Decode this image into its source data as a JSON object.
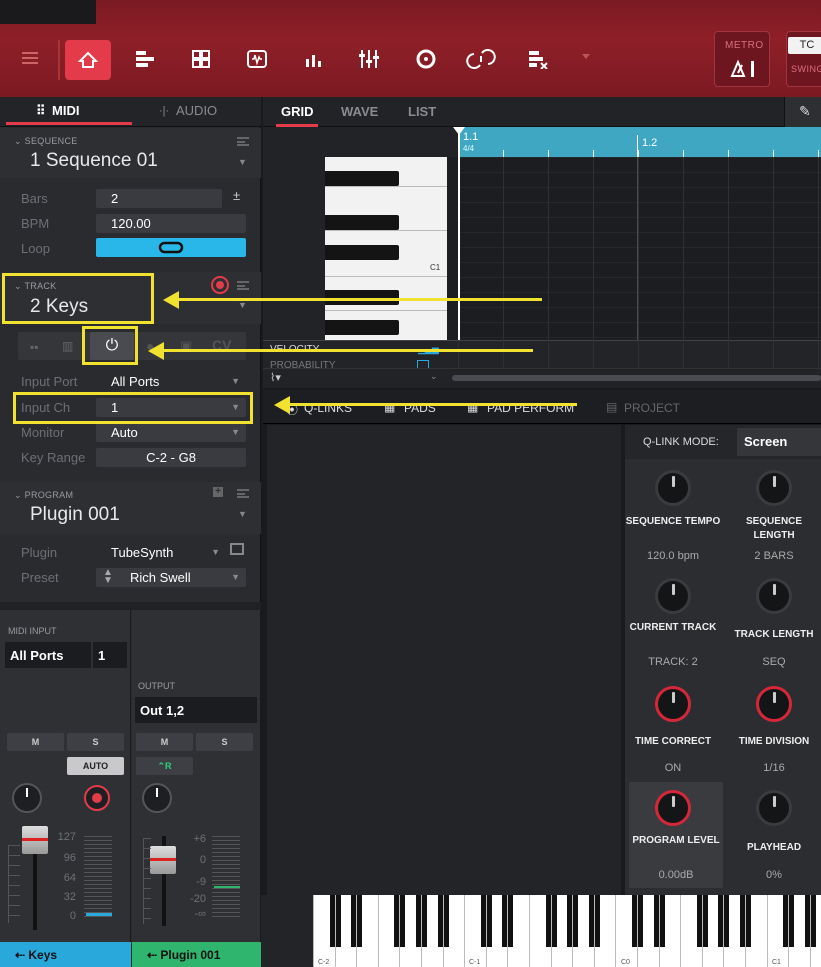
{
  "topbar": {
    "metro_label": "METRO",
    "tc_label": "TC",
    "swing_label": "SWING"
  },
  "left": {
    "tabs": {
      "midi": "MIDI",
      "audio": "AUDIO"
    },
    "sequence": {
      "header": "SEQUENCE",
      "title": "1 Sequence 01",
      "bars_label": "Bars",
      "bars_value": "2",
      "bpm_label": "BPM",
      "bpm_value": "120.00",
      "loop_label": "Loop"
    },
    "track": {
      "header": "TRACK",
      "title": "2 Keys",
      "cv_label": "CV",
      "input_port_label": "Input Port",
      "input_port_value": "All Ports",
      "input_ch_label": "Input Ch",
      "input_ch_value": "1",
      "monitor_label": "Monitor",
      "monitor_value": "Auto",
      "key_range_label": "Key Range",
      "key_range_value": "C-2 - G8"
    },
    "program": {
      "header": "PROGRAM",
      "title": "Plugin 001",
      "plugin_label": "Plugin",
      "plugin_value": "TubeSynth",
      "preset_label": "Preset",
      "preset_value": "Rich Swell"
    }
  },
  "mixer": {
    "midi_input_label": "MIDI INPUT",
    "midi_input_port": "All Ports",
    "midi_input_ch": "1",
    "output_label": "OUTPUT",
    "output_value": "Out 1,2",
    "mute": "M",
    "solo": "S",
    "auto_label": "AUTO",
    "read_label": "R",
    "scale_left": [
      "127",
      "96",
      "64",
      "32",
      "0"
    ],
    "scale_right": [
      "+6",
      "0",
      "-9",
      "-20",
      "-∞"
    ],
    "strip1_name": "Keys",
    "strip2_name": "Plugin 001"
  },
  "grid": {
    "tabs": {
      "grid": "GRID",
      "wave": "WAVE",
      "list": "LIST"
    },
    "ruler_1": "1.1",
    "ruler_sig": "4/4",
    "ruler_2": "1.2",
    "c1_label": "C1",
    "velocity_label": "VELOCITY",
    "probability_label": "PROBABILITY"
  },
  "qlinks": {
    "tabs": {
      "qlinks": "Q-LINKS",
      "pads": "PADS",
      "padperform": "PAD PERFORM",
      "project": "PROJECT"
    },
    "mode_label": "Q-LINK MODE:",
    "mode_value": "Screen",
    "k1_label": "SEQUENCE TEMPO",
    "k1_value": "120.0 bpm",
    "k2_label": "SEQUENCE LENGTH",
    "k2_value": "2 BARS",
    "k3_label": "CURRENT TRACK",
    "k3_value": "TRACK: 2",
    "k4_label": "TRACK LENGTH",
    "k4_value": "SEQ",
    "k5_label": "TIME CORRECT",
    "k5_value": "ON",
    "k6_label": "TIME DIVISION",
    "k6_value": "1/16",
    "k7_label": "PROGRAM LEVEL",
    "k7_value": "0.00dB",
    "k8_label": "PLAYHEAD",
    "k8_value": "0%"
  },
  "keyboard": {
    "labels": [
      "C-2",
      "C-1",
      "C0",
      "C1"
    ]
  },
  "colors": {
    "accent_red": "#e33b4a",
    "highlight_yellow": "#f2e230",
    "ruler_blue": "#3fa7c2",
    "strip_blue": "#29a8dc",
    "strip_green": "#2fb56e"
  }
}
